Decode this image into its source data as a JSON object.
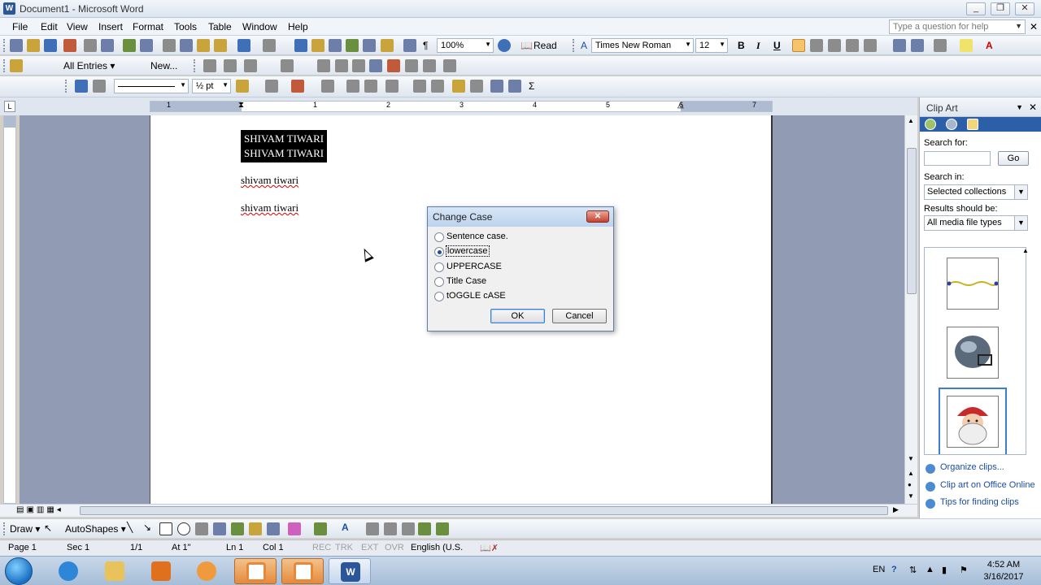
{
  "window": {
    "title": "Document1 - Microsoft Word",
    "minimize": "_",
    "restore": "❐",
    "close": "✕"
  },
  "menu": {
    "items": [
      "File",
      "Edit",
      "View",
      "Insert",
      "Format",
      "Tools",
      "Table",
      "Window",
      "Help"
    ],
    "help_placeholder": "Type a question for help"
  },
  "toolbar": {
    "zoom": "100%",
    "read_label": "Read",
    "font_name": "Times New Roman",
    "font_size": "12",
    "bold": "B",
    "italic": "I",
    "underline": "U",
    "all_entries": "All Entries ▾",
    "new_label": "New...",
    "line_weight": "½ pt"
  },
  "ruler": {
    "tab_selector": "L",
    "numbers": [
      "1",
      "1",
      "2",
      "3",
      "4",
      "5",
      "6",
      "7"
    ]
  },
  "document": {
    "line1": "SHIVAM TIWARI",
    "line2": "SHIVAM TIWARI",
    "line3": "shivam tiwari",
    "line4": "shivam tiwari"
  },
  "dialog": {
    "title": "Change Case",
    "options": [
      {
        "label": "Sentence case.",
        "selected": false
      },
      {
        "label": "lowercase",
        "selected": true
      },
      {
        "label": "UPPERCASE",
        "selected": false
      },
      {
        "label": "Title Case",
        "selected": false
      },
      {
        "label": "tOGGLE cASE",
        "selected": false
      }
    ],
    "ok": "OK",
    "cancel": "Cancel"
  },
  "clipart": {
    "title": "Clip Art",
    "search_for": "Search for:",
    "go": "Go",
    "search_in": "Search in:",
    "search_in_value": "Selected collections",
    "results_should_be": "Results should be:",
    "results_value": "All media file types",
    "links": [
      "Organize clips...",
      "Clip art on Office Online",
      "Tips for finding clips"
    ]
  },
  "drawbar": {
    "draw": "Draw ▾",
    "autoshapes": "AutoShapes ▾"
  },
  "status": {
    "page": "Page 1",
    "sec": "Sec 1",
    "pages": "1/1",
    "at": "At 1\"",
    "ln": "Ln 1",
    "col": "Col 1",
    "rec": "REC",
    "trk": "TRK",
    "ext": "EXT",
    "ovr": "OVR",
    "lang": "English (U.S."
  },
  "taskbar": {
    "lang": "EN",
    "time": "4:52 AM",
    "date": "3/16/2017"
  },
  "colors": {
    "doc_background": "#919bb3",
    "selection": "#000000",
    "dialog_title": "#bcd2ee",
    "close_button": "#c8402e",
    "taskbar": "#a6bdd8"
  }
}
